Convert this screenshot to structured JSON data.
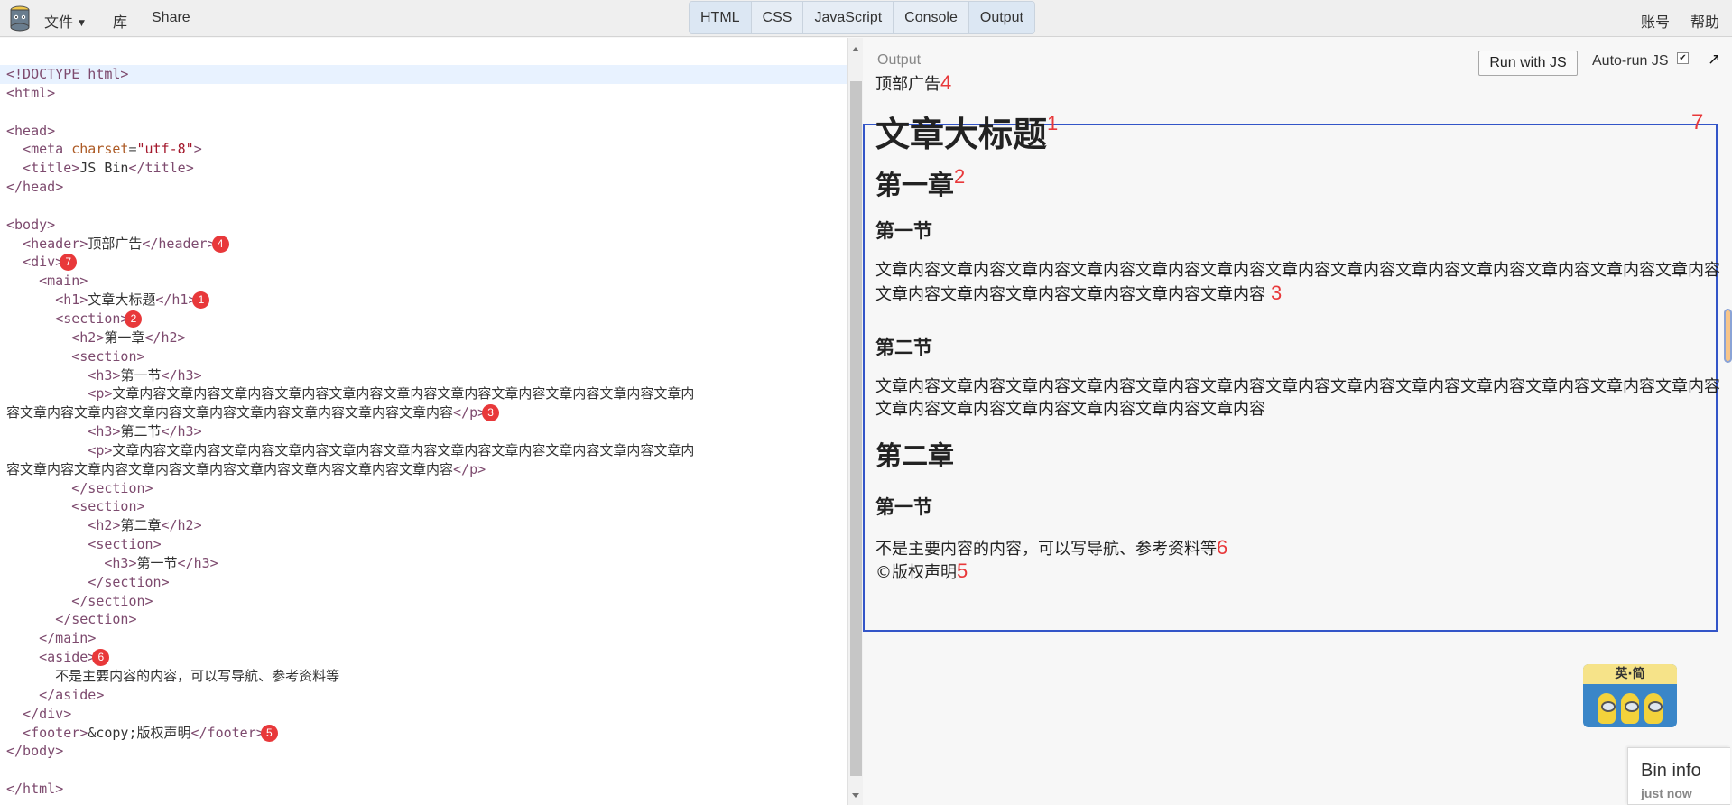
{
  "menu": {
    "file": "文件",
    "library": "库",
    "share": "Share",
    "account": "账号",
    "help": "帮助"
  },
  "panels": [
    "HTML",
    "CSS",
    "JavaScript",
    "Console",
    "Output"
  ],
  "editor": {
    "lines": [
      "<!DOCTYPE html>",
      "<html>",
      "",
      "<head>",
      "  <meta charset=\"utf-8\">",
      "  <title>JS Bin</title>",
      "</head>",
      "",
      "<body>",
      "  <header>顶部广告</header>",
      "  <div>",
      "    <main>",
      "      <h1>文章大标题</h1>",
      "      <section>",
      "        <h2>第一章</h2>",
      "        <section>",
      "          <h3>第一节</h3>",
      "          <p>文章内容文章内容文章内容文章内容文章内容文章内容文章内容文章内容文章内容文章内容文章内",
      "容文章内容文章内容文章内容文章内容文章内容文章内容文章内容文章内容</p>",
      "          <h3>第二节</h3>",
      "          <p>文章内容文章内容文章内容文章内容文章内容文章内容文章内容文章内容文章内容文章内容文章内",
      "容文章内容文章内容文章内容文章内容文章内容文章内容文章内容文章内容</p>",
      "        </section>",
      "        <section>",
      "          <h2>第二章</h2>",
      "          <section>",
      "            <h3>第一节</h3>",
      "          </section>",
      "        </section>",
      "      </section>",
      "    </main>",
      "    <aside>",
      "      不是主要内容的内容，可以写导航、参考资料等",
      "    </aside>",
      "  </div>",
      "  <footer>&copy;版权声明</footer>",
      "</body>",
      "",
      "</html>"
    ],
    "badges": {
      "9": "4",
      "10": "7",
      "12": "1",
      "13": "2",
      "18": "3",
      "31": "6",
      "35": "5"
    }
  },
  "output": {
    "label": "Output",
    "run_button": "Run with JS",
    "autorun_label": "Auto-run JS",
    "autorun_checked": "✔",
    "header_text": "顶部广告",
    "header_num": "4",
    "h1": "文章大标题",
    "h1_num": "1",
    "h2_1": "第一章",
    "h2_1_num": "2",
    "h3_1": "第一节",
    "p1": "文章内容文章内容文章内容文章内容文章内容文章内容文章内容文章内容文章内容文章内容文章内容文章内容文章内容文章内容文章内容文章内容文章内容文章内容文章内容",
    "p1_num": "3",
    "h3_2": "第二节",
    "p2": "文章内容文章内容文章内容文章内容文章内容文章内容文章内容文章内容文章内容文章内容文章内容文章内容文章内容文章内容文章内容文章内容文章内容文章内容文章内容",
    "h2_2": "第二章",
    "h3_3": "第一节",
    "aside": "不是主要内容的内容，可以写导航、参考资料等",
    "aside_num": "6",
    "footer": "©版权声明",
    "footer_num": "5",
    "box_num": "7",
    "sticker_text": "英·简",
    "bin_info_title": "Bin info",
    "bin_info_time": "just now"
  },
  "colors": {
    "badge": "#e8383a",
    "box": "#3355c8",
    "active_tab": "#dce7f3"
  }
}
